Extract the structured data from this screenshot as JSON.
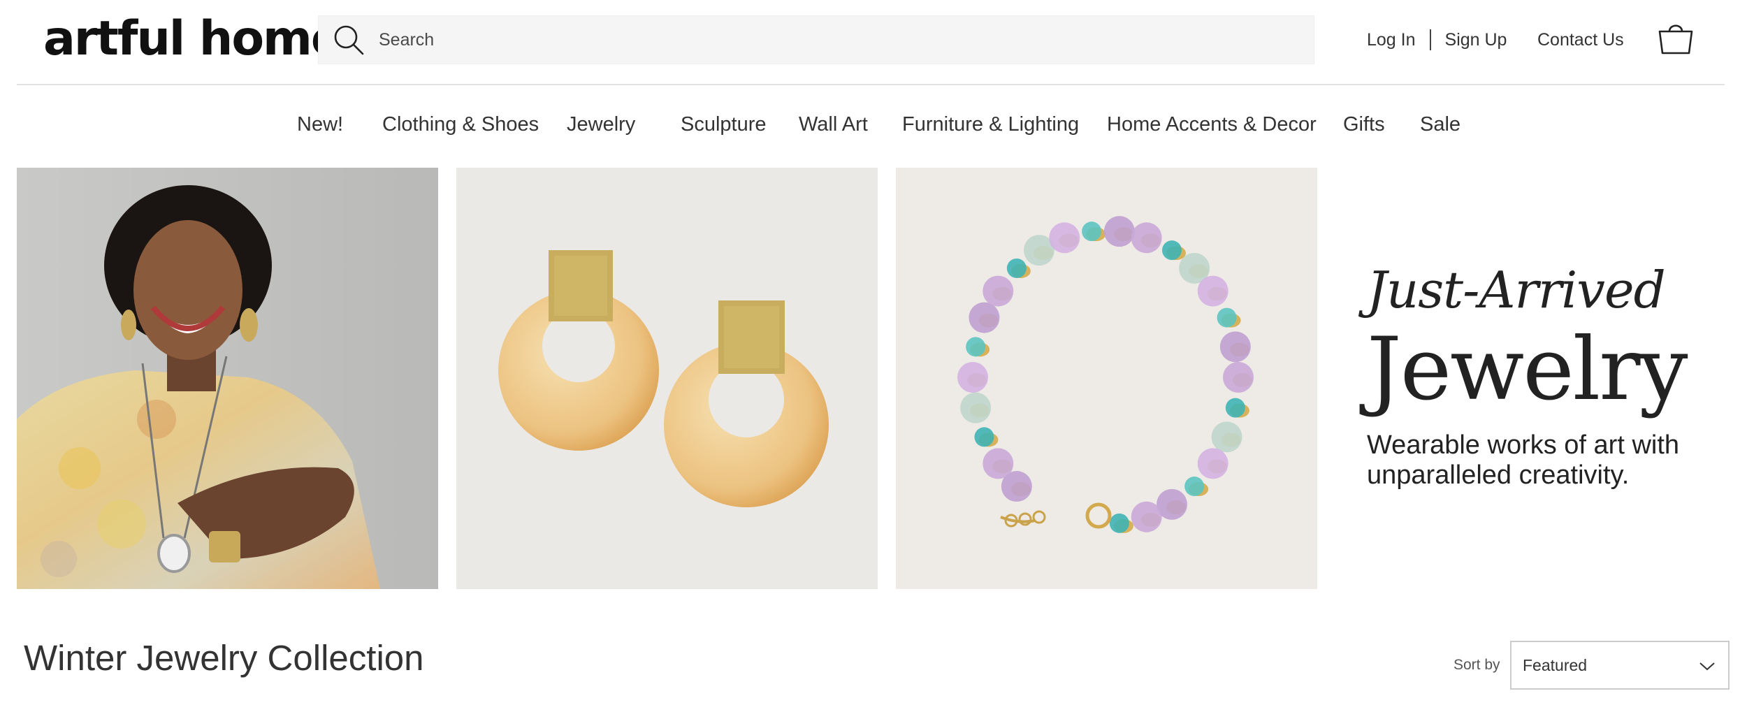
{
  "header": {
    "logo": "artful home",
    "search": {
      "placeholder": "Search",
      "value": ""
    },
    "login": "Log In",
    "signup": "Sign Up",
    "contact": "Contact Us"
  },
  "nav": {
    "items": [
      "New!",
      "Clothing & Shoes",
      "Jewelry",
      "Sculpture",
      "Wall Art",
      "Furniture & Lighting",
      "Home Accents & Decor",
      "Gifts",
      "Sale"
    ]
  },
  "hero": {
    "eyebrow": "Just-Arrived",
    "title": "Jewelry",
    "subtitle_line1": "Wearable works of art with",
    "subtitle_line2": "unparalleled creativity.",
    "images": [
      "model-wearing-jewelry",
      "gold-leaf-horn-earrings",
      "gemstone-bead-bracelet"
    ]
  },
  "collection": {
    "title": "Winter Jewelry Collection",
    "sort_label": "Sort by",
    "sort_value": "Featured"
  },
  "icons": [
    "search-icon",
    "shopping-bag-icon",
    "chevron-down-icon"
  ]
}
